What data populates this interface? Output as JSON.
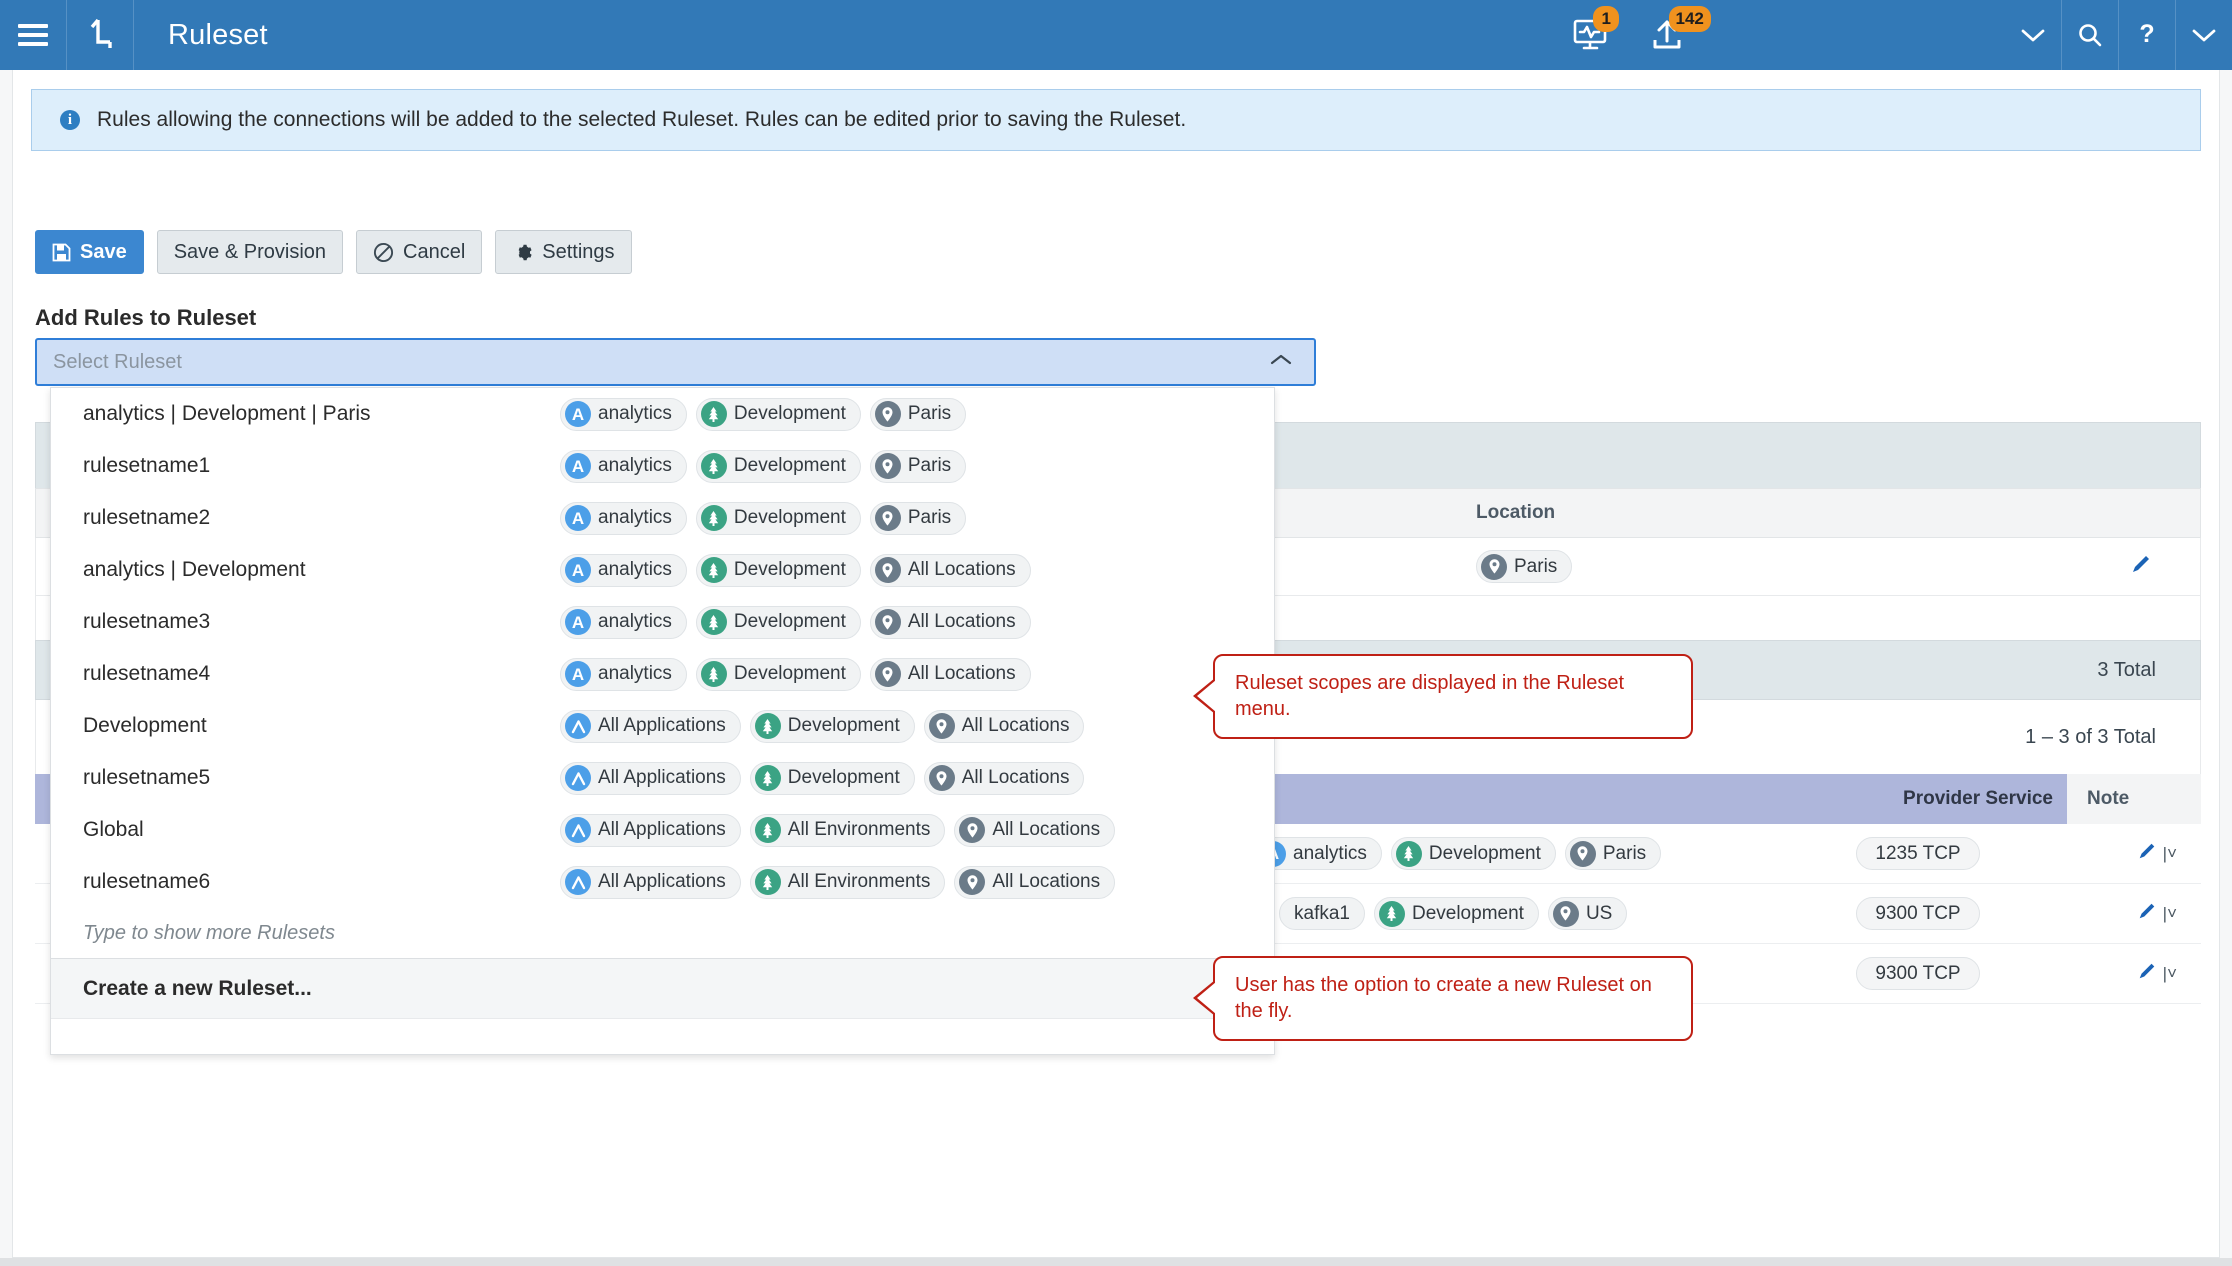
{
  "topbar": {
    "app_title": "Ruleset",
    "menu_icon": "hamburger-icon",
    "brand_icon": "illumio-logo-icon",
    "health_icon": "monitor-pulse-icon",
    "health_badge": "1",
    "provision_icon": "upload-icon",
    "provision_badge": "142",
    "chevron_icon": "chevron-down-icon",
    "search_icon": "search-icon",
    "help_icon": "help-question-icon",
    "user_chevron_icon": "chevron-down-icon",
    "accent": "#3279b7",
    "badge_color": "#f0921e"
  },
  "banner": {
    "icon": "info-icon",
    "icon_glyph": "i",
    "text": "Rules allowing the connections will be added to the selected Ruleset. Rules can be edited prior to saving the Ruleset."
  },
  "toolbar": {
    "save_label": "Save",
    "save_provision_label": "Save & Provision",
    "cancel_label": "Cancel",
    "settings_label": "Settings"
  },
  "add_rules": {
    "section_label": "Add Rules to Ruleset",
    "select_placeholder": "Select Ruleset",
    "select_value": ""
  },
  "dropdown": {
    "more_hint": "Type to show more Rulesets",
    "create_label": "Create a new Ruleset...",
    "items": [
      {
        "name": "analytics | Development | Paris",
        "app": "analytics",
        "app_icon": "application-icon",
        "env": "Development",
        "loc": "Paris"
      },
      {
        "name": "rulesetname1",
        "app": "analytics",
        "app_icon": "application-icon",
        "env": "Development",
        "loc": "Paris"
      },
      {
        "name": "rulesetname2",
        "app": "analytics",
        "app_icon": "application-icon",
        "env": "Development",
        "loc": "Paris"
      },
      {
        "name": "analytics | Development",
        "app": "analytics",
        "app_icon": "application-icon",
        "env": "Development",
        "loc": "All Locations"
      },
      {
        "name": "rulesetname3",
        "app": "analytics",
        "app_icon": "application-icon",
        "env": "Development",
        "loc": "All Locations"
      },
      {
        "name": "rulesetname4",
        "app": "analytics",
        "app_icon": "application-icon",
        "env": "Development",
        "loc": "All Locations"
      },
      {
        "name": "Development",
        "app": "All Applications",
        "app_icon": "all-applications-icon",
        "env": "Development",
        "loc": "All Locations"
      },
      {
        "name": "rulesetname5",
        "app": "All Applications",
        "app_icon": "all-applications-icon",
        "env": "Development",
        "loc": "All Locations"
      },
      {
        "name": "Global",
        "app": "All Applications",
        "app_icon": "all-applications-icon",
        "env": "All Environments",
        "loc": "All Locations"
      },
      {
        "name": "rulesetname6",
        "app": "All Applications",
        "app_icon": "all-applications-icon",
        "env": "All Environments",
        "loc": "All Locations"
      }
    ]
  },
  "background": {
    "scope_header_location": "Location",
    "scope_row_location": "Paris",
    "rules_total": "3 Total",
    "pagination": "1 – 3 of 3 Total",
    "col_provider_service": "Provider Service",
    "col_note": "Note",
    "rows": [
      {
        "app": "analytics",
        "env": "Development",
        "loc": "Paris",
        "service": "1235 TCP",
        "note": ""
      },
      {
        "app": "kafka1",
        "env": "Development",
        "loc": "US",
        "service": "9300 TCP",
        "note": ""
      },
      {
        "app": "",
        "env": "",
        "loc": "",
        "service": "9300 TCP",
        "note": ""
      }
    ]
  },
  "callouts": [
    {
      "text": "Ruleset scopes are displayed in the Ruleset menu."
    },
    {
      "text": "User has the option to create a new Ruleset on the fly."
    }
  ]
}
